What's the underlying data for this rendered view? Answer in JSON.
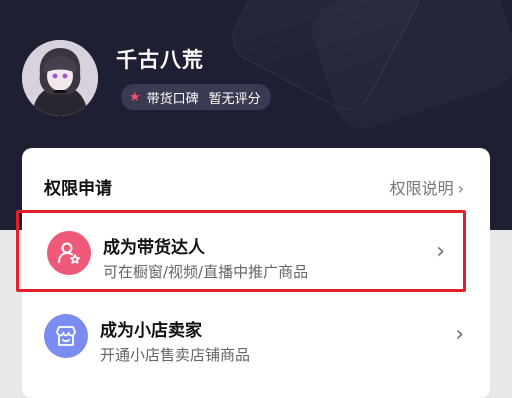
{
  "profile": {
    "name": "千古八荒",
    "rating_label": "带货口碑",
    "rating_value": "暂无评分"
  },
  "permissions": {
    "title": "权限申请",
    "help_link": "权限说明",
    "items": [
      {
        "title": "成为带货达人",
        "subtitle": "可在橱窗/视频/直播中推广商品",
        "icon": "person-star-icon",
        "color": "#f05a7a",
        "highlighted": true
      },
      {
        "title": "成为小店卖家",
        "subtitle": "开通小店售卖店铺商品",
        "icon": "shop-icon",
        "color": "#7a8cf0",
        "highlighted": false
      }
    ]
  },
  "colors": {
    "header_bg": "#1f1f33",
    "highlight_border": "#e2202a",
    "accent_pink": "#f05a7a",
    "accent_blue": "#7a8cf0"
  }
}
